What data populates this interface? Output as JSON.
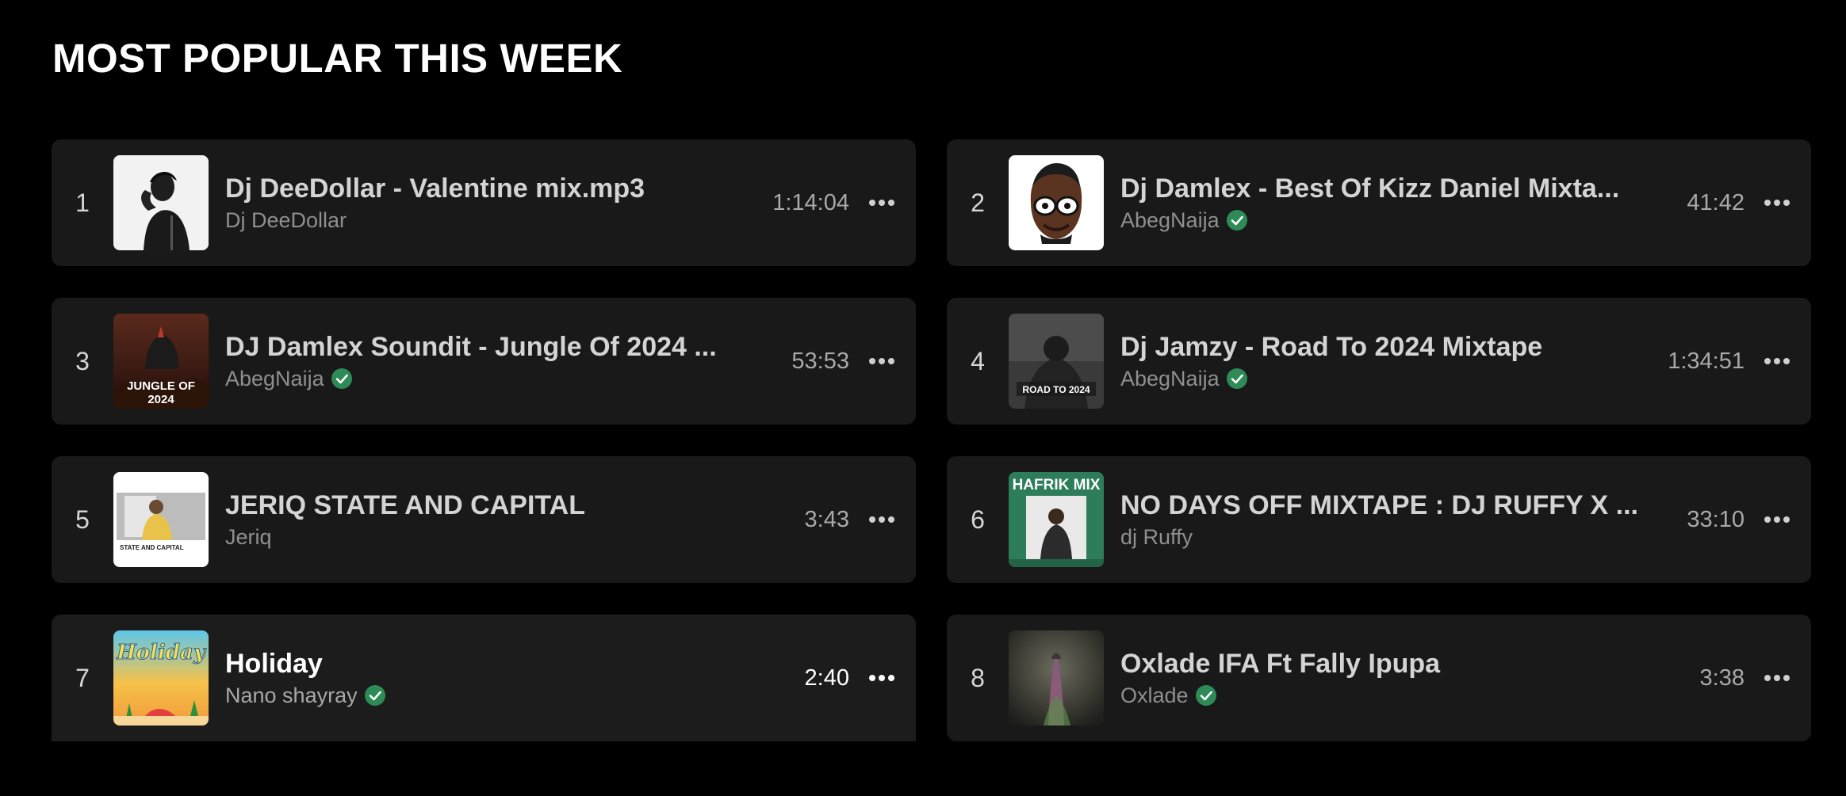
{
  "section": {
    "title": "MOST POPULAR THIS WEEK"
  },
  "colors": {
    "background": "#000000",
    "card": "#191919",
    "verified": "#2e8b57",
    "text_muted": "#8f8f8f"
  },
  "tracks": [
    {
      "rank": "1",
      "title": "Dj DeeDollar - Valentine mix.mp3",
      "artist": "Dj DeeDollar",
      "duration": "1:14:04",
      "verified": false,
      "cover_icon": "album-cover-deedollar"
    },
    {
      "rank": "2",
      "title": "Dj Damlex - Best Of Kizz Daniel Mixta...",
      "artist": "AbegNaija",
      "duration": "41:42",
      "verified": true,
      "cover_icon": "album-cover-damlex-kizz"
    },
    {
      "rank": "3",
      "title": "DJ Damlex Soundit - Jungle Of 2024 ...",
      "artist": "AbegNaija",
      "duration": "53:53",
      "verified": true,
      "cover_icon": "album-cover-jungle-of-2024",
      "cover_text": [
        "JUNGLE OF",
        "2024"
      ]
    },
    {
      "rank": "4",
      "title": "Dj Jamzy - Road To 2024 Mixtape",
      "artist": "AbegNaija",
      "duration": "1:34:51",
      "verified": true,
      "cover_icon": "album-cover-road-to-2024",
      "cover_text": [
        "ROAD TO 2024"
      ]
    },
    {
      "rank": "5",
      "title": "JERIQ STATE AND CAPITAL",
      "artist": "Jeriq",
      "duration": "3:43",
      "verified": false,
      "cover_icon": "album-cover-state-and-capital",
      "cover_text": [
        "STATE AND CAPITAL"
      ]
    },
    {
      "rank": "6",
      "title": "NO DAYS OFF MIXTAPE : DJ RUFFY X ...",
      "artist": "dj Ruffy",
      "duration": "33:10",
      "verified": false,
      "cover_icon": "album-cover-hafrik-mix",
      "cover_text": [
        "HAFRIK MIX"
      ]
    },
    {
      "rank": "7",
      "title": "Holiday",
      "artist": "Nano shayray",
      "duration": "2:40",
      "verified": true,
      "cover_icon": "album-cover-holiday",
      "cover_text": [
        "Holiday"
      ]
    },
    {
      "rank": "8",
      "title": "Oxlade IFA Ft Fally Ipupa",
      "artist": "Oxlade",
      "duration": "3:38",
      "verified": true,
      "cover_icon": "album-cover-oxlade-ifa"
    }
  ]
}
